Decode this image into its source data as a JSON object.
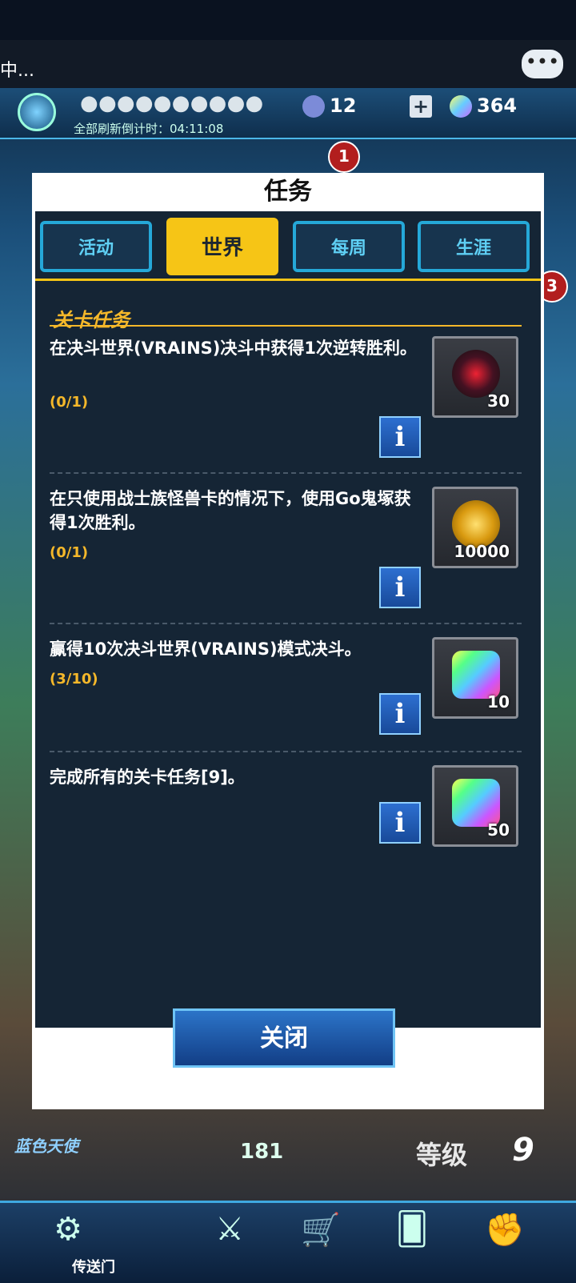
{
  "status": {
    "left_text": "中..."
  },
  "topbar": {
    "refresh_label": "全部刷新倒计时：04:11:08",
    "stat1": "12",
    "stat2": "364",
    "notif_top": "1",
    "notif_right": "3"
  },
  "dialog": {
    "title": "任务",
    "tabs": [
      {
        "label": "活动"
      },
      {
        "label": "世界"
      },
      {
        "label": "每周"
      },
      {
        "label": "生涯"
      }
    ],
    "active_tab": "世界",
    "section_title": "关卡任务",
    "missions": [
      {
        "desc": "在决斗世界(VRAINS)决斗中获得1次逆转胜利。",
        "progress": "(0/1)",
        "reward_icon": "trap-card-orb-icon",
        "reward_qty": "30"
      },
      {
        "desc": "在只使用战士族怪兽卡的情况下，使用Go鬼塚获得1次胜利。",
        "progress": "(0/1)",
        "reward_icon": "gold-coins-icon",
        "reward_qty": "10000"
      },
      {
        "desc": "赢得10次决斗世界(VRAINS)模式决斗。",
        "progress": "(3/10)",
        "reward_icon": "gem-icon",
        "reward_qty": "10"
      },
      {
        "desc": "完成所有的关卡任务[9]。",
        "progress": "",
        "reward_icon": "gem-icon",
        "reward_qty": "50"
      }
    ],
    "info_glyph": "i",
    "close_label": "关闭"
  },
  "bottom": {
    "logo": "蓝色天使",
    "points": "181",
    "level_label": "等级",
    "level_value": "9",
    "nav_gate_label": "传送门"
  },
  "colors": {
    "accent": "#f5b82a",
    "panel": "#152535",
    "tab_border": "#25a8d8"
  }
}
